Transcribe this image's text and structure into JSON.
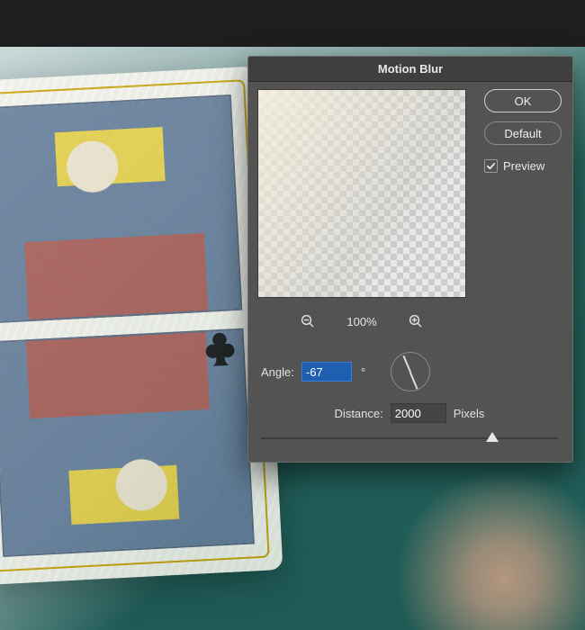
{
  "dialog": {
    "title": "Motion Blur",
    "ok_label": "OK",
    "default_label": "Default",
    "preview_label": "Preview",
    "preview_checked": true,
    "zoom_label": "100%",
    "angle_label": "Angle:",
    "angle_value": "-67",
    "angle_unit": "°",
    "angle_deg": -67,
    "distance_label": "Distance:",
    "distance_value": "2000",
    "distance_unit": "Pixels",
    "slider_pct": 78
  }
}
